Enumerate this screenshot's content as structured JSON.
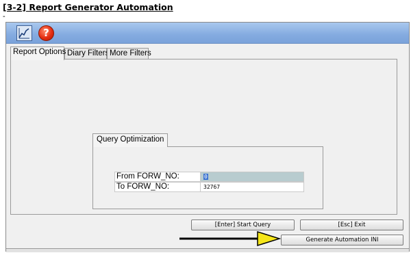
{
  "heading": "[3-2] Report Generator Automation",
  "dash": "-",
  "toolbar": {
    "chart_icon": "chart-icon",
    "help_icon": "help-icon",
    "help_glyph": "?"
  },
  "tabs": [
    {
      "label": "Report Options",
      "active": true
    },
    {
      "label": "Diary Filters",
      "active": false
    },
    {
      "label": "More Filters",
      "active": false
    }
  ],
  "query_optimization": {
    "title": "Query Optimization",
    "from_label": "From FORW_NO:",
    "from_value": "0",
    "to_label": "To FORW_NO:",
    "to_value": "32767"
  },
  "buttons": {
    "start_query": "[Enter] Start Query",
    "exit": "[Esc] Exit",
    "generate_ini": "Generate Automation INI"
  },
  "colors": {
    "toolbar": "#84abe0",
    "arrow": "#f5e61a"
  }
}
